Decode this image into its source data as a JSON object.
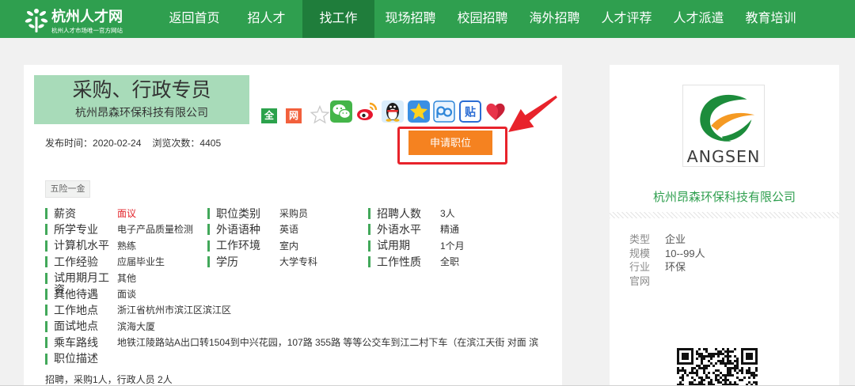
{
  "header": {
    "logo_title": "杭州人才网",
    "logo_subtitle": "杭州人才市场唯一官方网站",
    "nav": [
      {
        "label": "返回首页",
        "active": false
      },
      {
        "label": "招人才",
        "active": false
      },
      {
        "label": "找工作",
        "active": true
      },
      {
        "label": "现场招聘",
        "active": false
      },
      {
        "label": "校园招聘",
        "active": false
      },
      {
        "label": "海外招聘",
        "active": false
      },
      {
        "label": "人才评荐",
        "active": false
      },
      {
        "label": "人才派遣",
        "active": false
      },
      {
        "label": "教育培训",
        "active": false
      }
    ]
  },
  "job": {
    "title": "采购、行政专员",
    "company": "杭州昂森环保科技有限公司",
    "badges": [
      {
        "text": "全"
      },
      {
        "text": "网"
      }
    ],
    "share_icons": [
      "favorite-star-icon",
      "wechat-icon",
      "weibo-icon",
      "qq-icon",
      "qzone-icon",
      "pengyou-icon",
      "tieba-icon",
      "heart-icon"
    ],
    "tieba_glyph": "贴",
    "publish_label": "发布时间：",
    "publish_date": "2020-02-24",
    "views_label": "浏览次数：",
    "views": "4405",
    "apply_label": "申请职位",
    "benefits": [
      "五险一金"
    ],
    "grid": [
      [
        {
          "label": "薪资",
          "value": "面议"
        },
        {
          "label": "职位类别",
          "value": "采购员"
        },
        {
          "label": "招聘人数",
          "value": "3人"
        }
      ],
      [
        {
          "label": "所学专业",
          "value": "电子产品质量检测"
        },
        {
          "label": "外语语种",
          "value": "英语"
        },
        {
          "label": "外语水平",
          "value": "精通"
        }
      ],
      [
        {
          "label": "计算机水平",
          "value": "熟练"
        },
        {
          "label": "工作环境",
          "value": "室内"
        },
        {
          "label": "试用期",
          "value": "1个月"
        }
      ],
      [
        {
          "label": "工作经验",
          "value": "应届毕业生"
        },
        {
          "label": "学历",
          "value": "大学专科"
        },
        {
          "label": "工作性质",
          "value": "全职"
        }
      ]
    ],
    "rows": [
      {
        "label": "试用期月工资",
        "value": "其他"
      },
      {
        "label": "其他待遇",
        "value": "面谈"
      },
      {
        "label": "工作地点",
        "value": "浙江省杭州市滨江区滨江区"
      },
      {
        "label": "面试地点",
        "value": "滨海大厦"
      },
      {
        "label": "乘车路线",
        "value": "地铁江陵路站A出口转1504到中兴花园，107路 355路 等等公交车到江二村下车（在滨江天街 对面 滨"
      }
    ],
    "description_label": "职位描述",
    "description": "招聘，采购1人，行政人员 2人"
  },
  "company_card": {
    "logo_text": "ANGSEN",
    "name": "杭州昂森环保科技有限公司",
    "info": [
      {
        "label": "类型",
        "value": "企业"
      },
      {
        "label": "规模",
        "value": "10--99人"
      },
      {
        "label": "行业",
        "value": "环保"
      },
      {
        "label": "官网"
      }
    ]
  },
  "colors": {
    "nav_bg": "#2f9f4f",
    "nav_active": "#1f7d3b",
    "title_box": "#a8dbb9",
    "accent_green": "#2f9f4f",
    "apply_button": "#f58220",
    "salary_text": "#e3242b",
    "highlight_frame": "#e8232b",
    "badge_quan": "#2ca24c",
    "badge_wang": "#f2603c",
    "marker_green": "#42a85a"
  }
}
